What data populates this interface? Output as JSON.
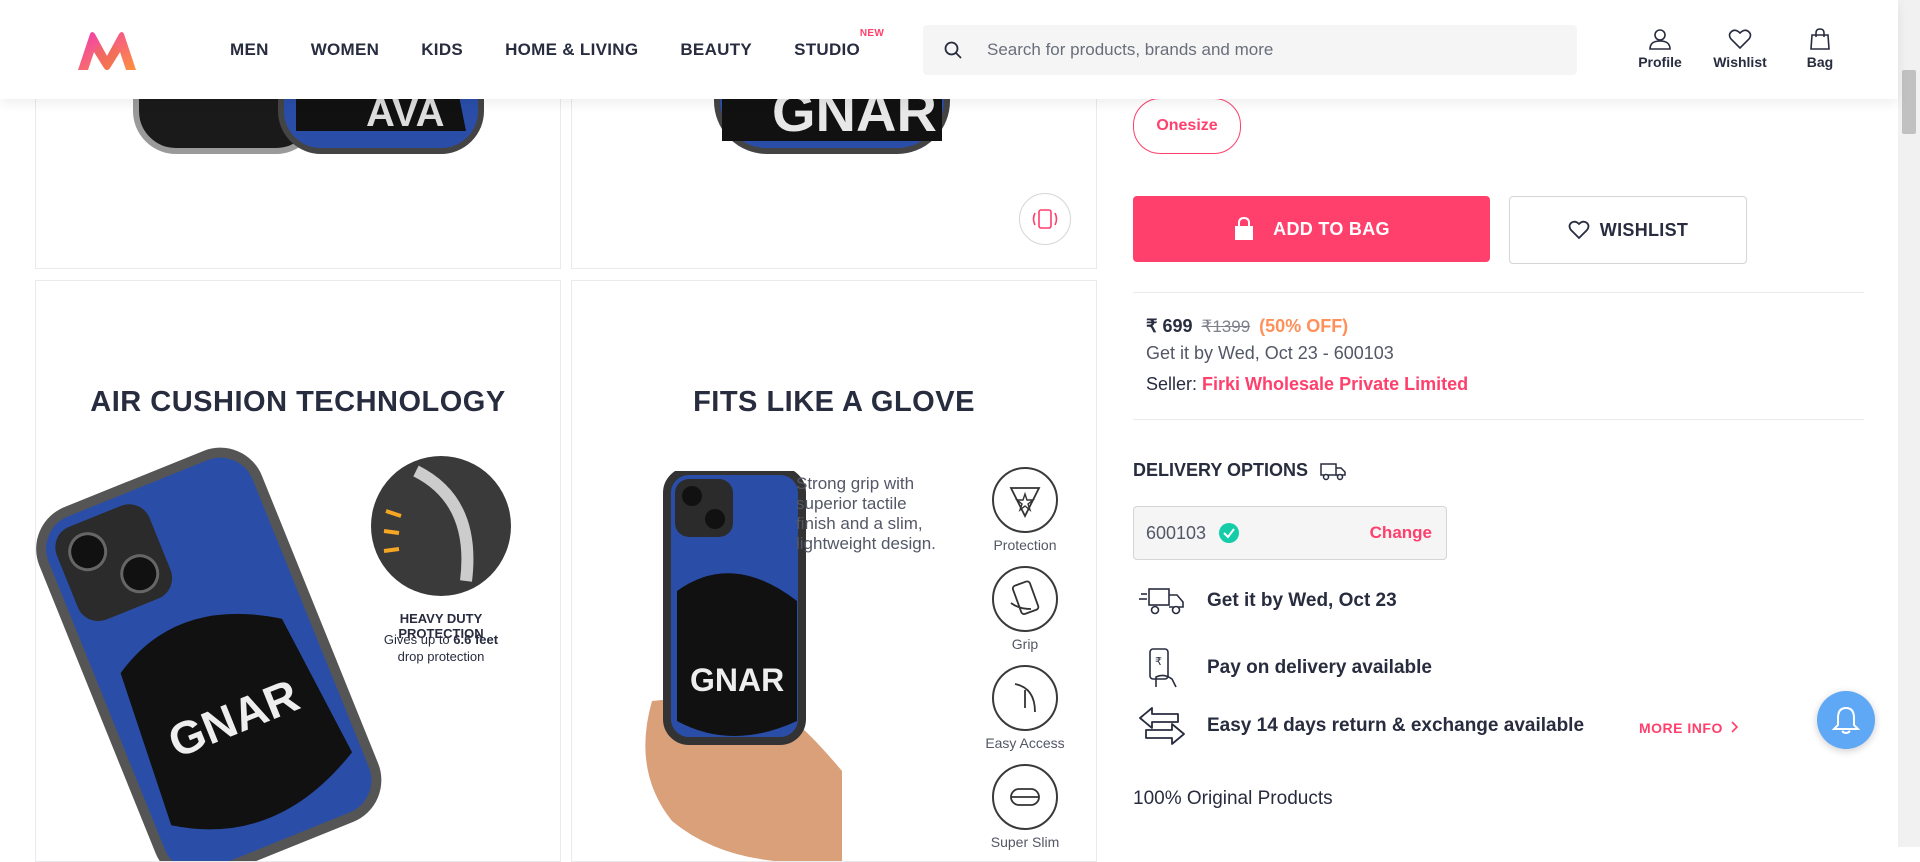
{
  "header": {
    "nav": [
      {
        "label": "MEN"
      },
      {
        "label": "WOMEN"
      },
      {
        "label": "KIDS"
      },
      {
        "label": "HOME & LIVING"
      },
      {
        "label": "BEAUTY"
      },
      {
        "label": "STUDIO",
        "badge": "NEW"
      }
    ],
    "search_placeholder": "Search for products, brands and more",
    "actions": {
      "profile": "Profile",
      "wishlist": "Wishlist",
      "bag": "Bag"
    }
  },
  "gallery": {
    "tile3": {
      "heading": "AIR CUSHION TECHNOLOGY",
      "protection_title": "HEAVY DUTY PROTECTION",
      "protection_prefix": "Gives up to ",
      "protection_bold": "6.6 feet",
      "protection_suffix": "drop protection"
    },
    "tile4": {
      "heading": "FITS LIKE A GLOVE",
      "desc_lines": [
        "Strong grip with",
        "superior tactile",
        "finish and a slim,",
        "lightweight design."
      ],
      "features": [
        "Protection",
        "Grip",
        "Easy Access",
        "Super Slim"
      ]
    }
  },
  "product": {
    "size": "Onesize",
    "add_to_bag": "ADD TO BAG",
    "wishlist": "WISHLIST",
    "price": "₹ 699",
    "mrp": "₹1399",
    "discount": "(50% OFF)",
    "eta": "Get it by Wed, Oct 23 - 600103",
    "seller_label": "Seller: ",
    "seller_name": "Firki Wholesale Private Limited"
  },
  "delivery": {
    "title": "DELIVERY OPTIONS",
    "pincode": "600103",
    "change": "Change",
    "rows": [
      "Get it by Wed, Oct 23",
      "Pay on delivery available",
      "Easy 14 days return & exchange available"
    ],
    "more_info": "MORE INFO",
    "original": "100% Original Products"
  },
  "colors": {
    "accent": "#ff3f6c",
    "discount": "#ff905a",
    "text": "#282c3f",
    "muted": "#535766"
  }
}
